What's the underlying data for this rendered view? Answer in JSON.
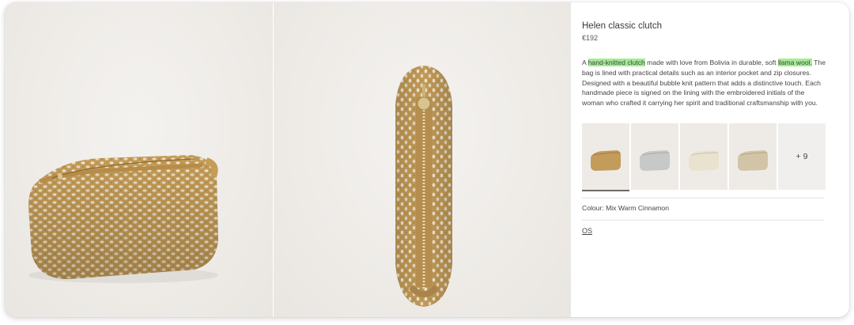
{
  "product": {
    "title": "Helen classic clutch",
    "price": "€192",
    "description": {
      "p1": "A ",
      "h1": "hand-knitted clutch",
      "p2": " made with love from Bolivia in durable, soft ",
      "h2": "llama wool.",
      "p3": " The bag is lined with practical details such as an interior pocket and zip closures. Designed with a beautiful bubble knit pattern that adds a distinctive touch. Each handmade piece is signed on the lining with the embroidered initials of the woman who crafted it carrying her spirit and traditional craftsmanship with you."
    },
    "colour_label": "Colour: Mix Warm Cinnamon",
    "size_option": "OS"
  },
  "thumbnails": {
    "items": [
      {
        "color": "cinnamon",
        "selected": true
      },
      {
        "color": "grey",
        "selected": false
      },
      {
        "color": "cream",
        "selected": false
      },
      {
        "color": "beige",
        "selected": false
      }
    ],
    "more_label": "+ 9"
  },
  "colors": {
    "highlight": "#a5ec95",
    "knit_base": "#c9a361",
    "knit_light": "#efe6d2",
    "background": "#eeebe7"
  }
}
